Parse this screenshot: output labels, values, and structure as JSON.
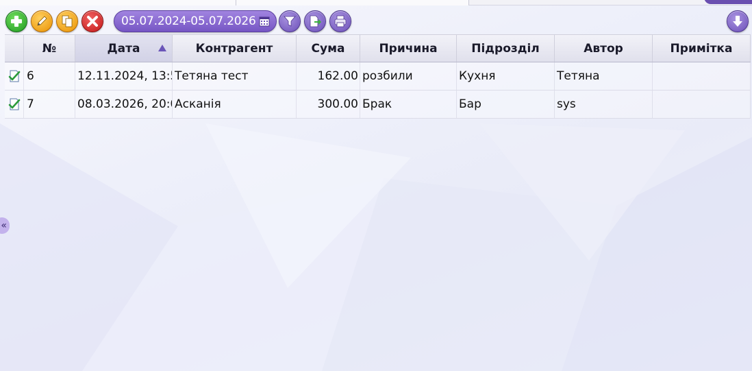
{
  "toolbar": {
    "date_range": "05.07.2024-05.07.2026",
    "icons": [
      "add-icon",
      "edit-icon",
      "copy-icon",
      "delete-icon",
      "calendar-icon",
      "filter-icon",
      "export-icon",
      "print-icon",
      "download-icon"
    ]
  },
  "table": {
    "columns": [
      "",
      "№",
      "Дата",
      "Контрагент",
      "Сума",
      "Причина",
      "Підрозділ",
      "Автор",
      "Примітка"
    ],
    "sorted_column": "Дата",
    "rows": [
      {
        "num": "6",
        "date": "12.11.2024, 13:5",
        "contractor": "Тетяна тест",
        "sum": "162.00",
        "reason": "розбили",
        "department": "Кухня",
        "author": "Тетяна",
        "note": ""
      },
      {
        "num": "7",
        "date": "08.03.2026, 20:0",
        "contractor": "Асканія",
        "sum": "300.00",
        "reason": "Брак",
        "department": "Бар",
        "author": "sys",
        "note": ""
      }
    ]
  },
  "side_handle": "«",
  "colors": {
    "accent": "#7656c4",
    "add": "#1f9a20",
    "edit": "#e99000",
    "delete": "#c21818"
  }
}
